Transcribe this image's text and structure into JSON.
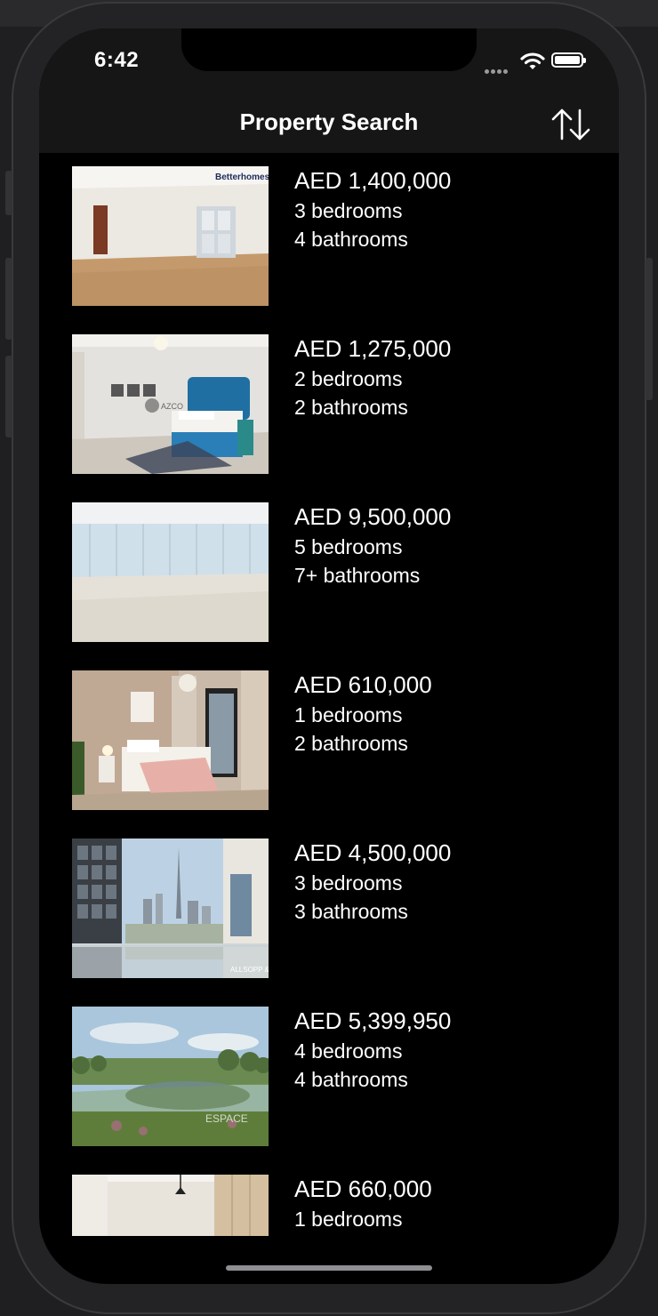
{
  "status_bar": {
    "time": "6:42"
  },
  "nav": {
    "title": "Property Search",
    "sort_icon": "sort-arrows-icon"
  },
  "listings": [
    {
      "price": "AED 1,400,000",
      "bedrooms": "3 bedrooms",
      "bathrooms": "4 bathrooms",
      "watermark": "Betterhomes."
    },
    {
      "price": "AED 1,275,000",
      "bedrooms": "2 bedrooms",
      "bathrooms": "2 bathrooms",
      "watermark": "AZCO"
    },
    {
      "price": "AED 9,500,000",
      "bedrooms": "5 bedrooms",
      "bathrooms": "7+ bathrooms",
      "watermark": ""
    },
    {
      "price": "AED 610,000",
      "bedrooms": "1 bedrooms",
      "bathrooms": "2 bathrooms",
      "watermark": ""
    },
    {
      "price": "AED 4,500,000",
      "bedrooms": "3 bedrooms",
      "bathrooms": "3 bathrooms",
      "watermark": "ALLSOPP & ALLSOPP"
    },
    {
      "price": "AED 5,399,950",
      "bedrooms": "4 bedrooms",
      "bathrooms": "4 bathrooms",
      "watermark": "ESPACE"
    },
    {
      "price": "AED 660,000",
      "bedrooms": "1 bedrooms",
      "bathrooms": ""
    }
  ]
}
